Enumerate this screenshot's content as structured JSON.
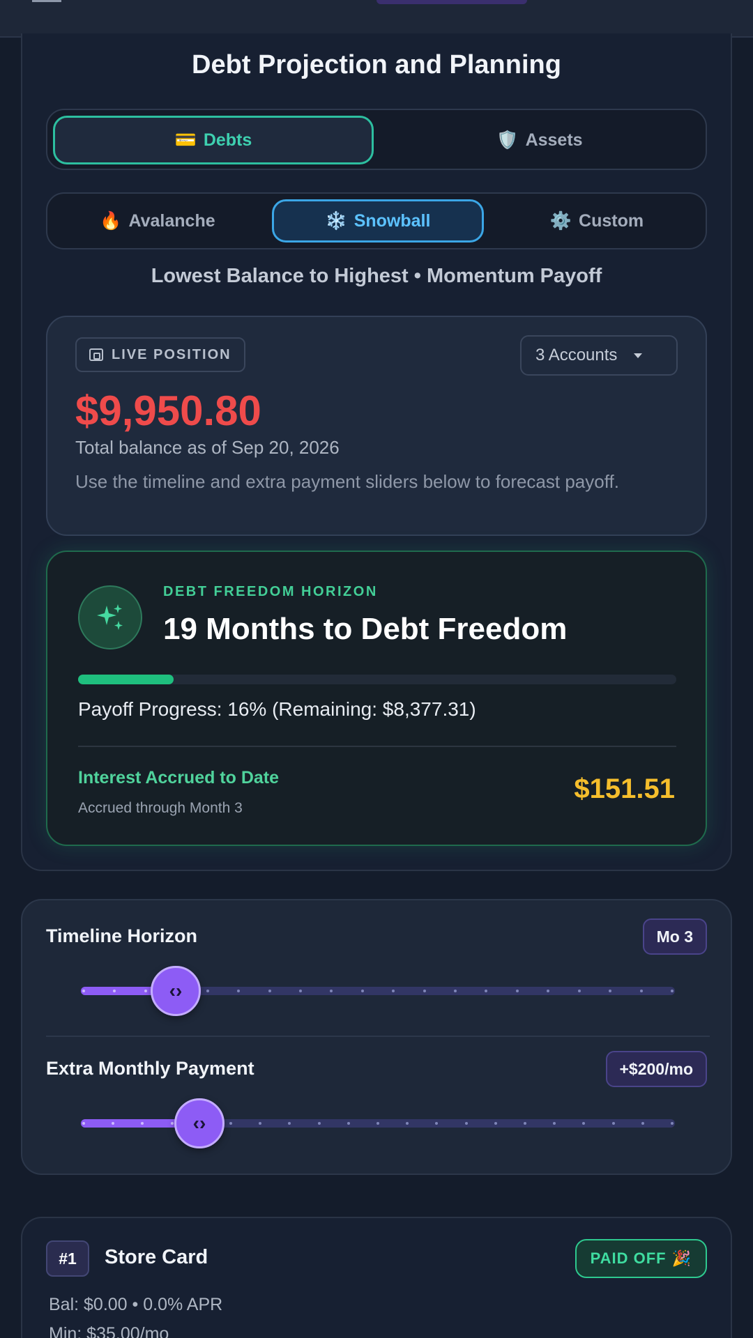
{
  "page": {
    "title": "Debt Projection and Planning"
  },
  "category_tabs": [
    {
      "icon": "credit-card-icon",
      "glyph": "💳",
      "label": "Debts",
      "active": true
    },
    {
      "icon": "shield-icon",
      "glyph": "🛡️",
      "label": "Assets",
      "active": false
    }
  ],
  "strategy_tabs": [
    {
      "icon": "fire-icon",
      "glyph": "🔥",
      "label": "Avalanche",
      "active": false
    },
    {
      "icon": "snowflake-icon",
      "glyph": "❄️",
      "label": "Snowball",
      "active": true
    },
    {
      "icon": "gear-icon",
      "glyph": "⚙️",
      "label": "Custom",
      "active": false
    }
  ],
  "strategy_description": "Lowest Balance to Highest • Momentum Payoff",
  "live_position": {
    "badge": "LIVE POSITION",
    "accounts_selector": "3 Accounts",
    "total_balance": "$9,950.80",
    "as_of": "Total balance as of Sep 20, 2026",
    "note": "Use the timeline and extra payment sliders below to forecast payoff."
  },
  "freedom": {
    "label": "DEBT FREEDOM HORIZON",
    "headline": "19 Months to Debt Freedom",
    "progress_percent": 16,
    "progress_text": "Payoff Progress: 16% (Remaining: $8,377.31)",
    "interest_label": "Interest Accrued to Date",
    "interest_sub": "Accrued through Month 3",
    "interest_amount": "$151.51"
  },
  "sliders": {
    "timeline": {
      "label": "Timeline Horizon",
      "value_badge": "Mo 3",
      "fraction": 0.16,
      "thumb_glyph": "‹›"
    },
    "extra_payment": {
      "label": "Extra Monthly Payment",
      "value_badge": "+$200/mo",
      "fraction": 0.2,
      "thumb_glyph": "‹›"
    }
  },
  "debts": [
    {
      "rank": "#1",
      "name": "Store Card",
      "status": "PAID OFF",
      "status_glyph": "🎉",
      "balance_line": "Bal: $0.00  •  0.0% APR",
      "min_line": "Min: $35.00/mo"
    }
  ],
  "colors": {
    "background": "#141c2b",
    "accent_green": "#3ed0b0",
    "accent_blue": "#5cc2ff",
    "balance_red": "#ef4b4b",
    "interest_gold": "#f5be2c",
    "slider_purple": "#8d5cf5"
  }
}
